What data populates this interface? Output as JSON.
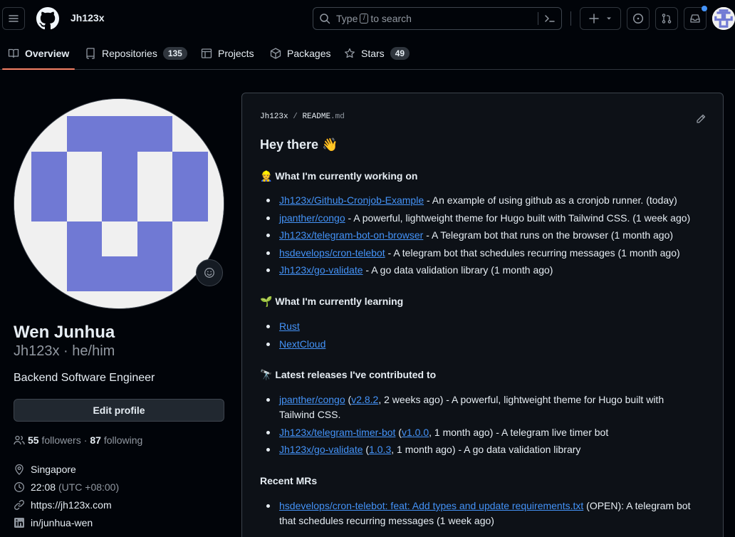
{
  "header": {
    "owner": "Jh123x",
    "search_prefix": "Type",
    "search_key": "/",
    "search_suffix": "to search"
  },
  "tabs": [
    {
      "label": "Overview"
    },
    {
      "label": "Repositories",
      "count": "135"
    },
    {
      "label": "Projects"
    },
    {
      "label": "Packages"
    },
    {
      "label": "Stars",
      "count": "49"
    }
  ],
  "profile": {
    "name": "Wen Junhua",
    "login": "Jh123x · he/him",
    "bio": "Backend Software Engineer",
    "edit_label": "Edit profile",
    "followers_count": "55",
    "followers_label": "followers",
    "following_count": "87",
    "following_label": "following",
    "location": "Singapore",
    "time": "22:08",
    "timezone": "(UTC +08:00)",
    "website": "https://jh123x.com",
    "linkedin": "in/junhua-wen"
  },
  "readme": {
    "owner": "Jh123x",
    "slash": "/",
    "file": "README",
    "ext": ".md",
    "title": "Hey there 👋",
    "working_heading": "👷 What I'm currently working on",
    "working": [
      {
        "link": "Jh123x/Github-Cronjob-Example",
        "desc": " - An example of using github as a cronjob runner. (today)"
      },
      {
        "link": "jpanther/congo",
        "desc": " - A powerful, lightweight theme for Hugo built with Tailwind CSS. (1 week ago)"
      },
      {
        "link": "Jh123x/telegram-bot-on-browser",
        "desc": " - A Telegram bot that runs on the browser (1 month ago)"
      },
      {
        "link": "hsdevelops/cron-telebot",
        "desc": " - A telegram bot that schedules recurring messages (1 month ago)"
      },
      {
        "link": "Jh123x/go-validate",
        "desc": " - A go data validation library (1 month ago)"
      }
    ],
    "learning_heading": "🌱 What I'm currently learning",
    "learning": [
      "Rust",
      "NextCloud"
    ],
    "releases_heading": "🔭 Latest releases I've contributed to",
    "releases": [
      {
        "link": "jpanther/congo",
        "version": "v2.8.2",
        "rest": ", 2 weeks ago) - A powerful, lightweight theme for Hugo built with Tailwind CSS."
      },
      {
        "link": "Jh123x/telegram-timer-bot",
        "version": "v1.0.0",
        "rest": ", 1 month ago) - A telegram live timer bot"
      },
      {
        "link": "Jh123x/go-validate",
        "version": "1.0.3",
        "rest": ", 1 month ago) - A go data validation library"
      }
    ],
    "mrs_heading": "Recent MRs",
    "mrs": [
      {
        "link": "hsdevelops/cron-telebot: feat: Add types and update requirements.txt",
        "desc": " (OPEN): A telegram bot that schedules recurring messages (1 week ago)"
      }
    ]
  },
  "colors": {
    "accent_link": "#4493f8",
    "tab_underline": "#f78166",
    "identicon": "#7079d4"
  }
}
